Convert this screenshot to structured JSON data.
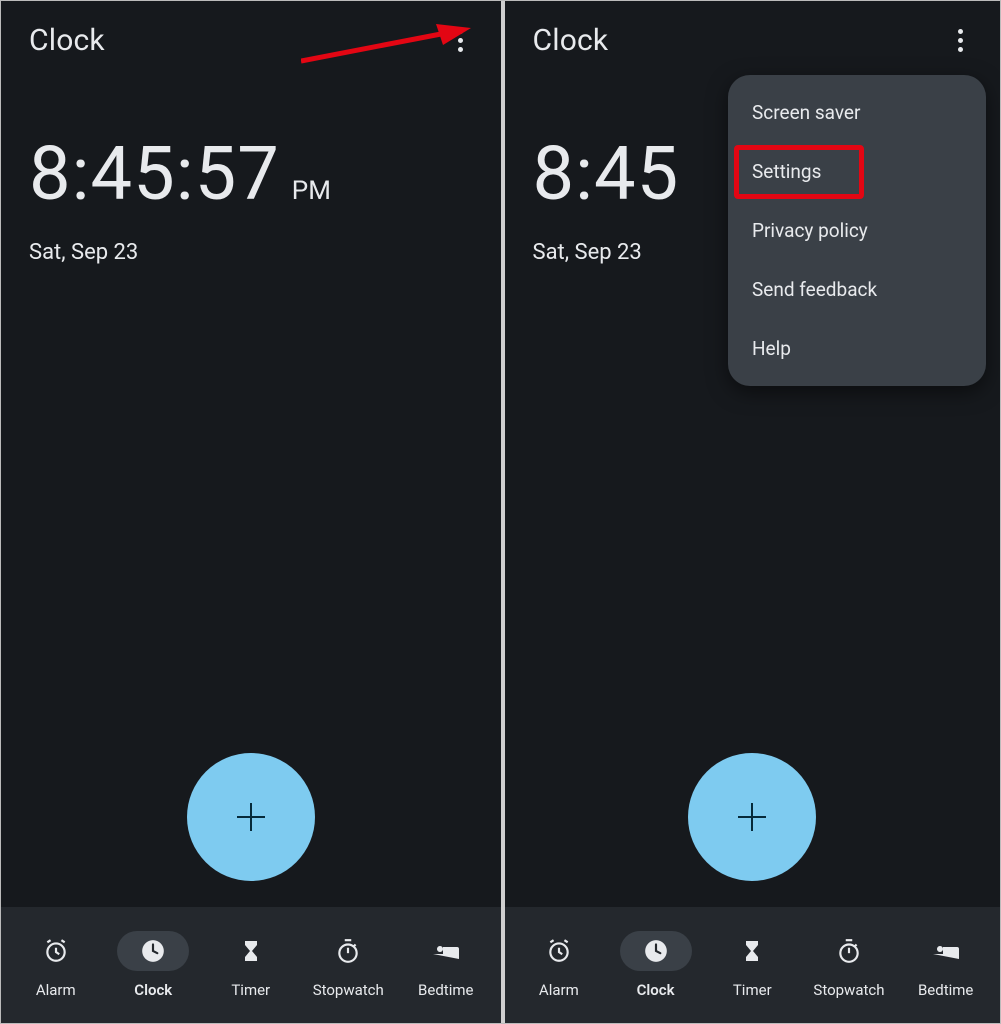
{
  "left": {
    "title": "Clock",
    "time": "8:45:57",
    "ampm": "PM",
    "date": "Sat, Sep 23"
  },
  "right": {
    "title": "Clock",
    "time": "8:45",
    "ampm": "",
    "date": "Sat, Sep 23",
    "menu": {
      "items": [
        {
          "label": "Screen saver"
        },
        {
          "label": "Settings"
        },
        {
          "label": "Privacy policy"
        },
        {
          "label": "Send feedback"
        },
        {
          "label": "Help"
        }
      ],
      "highlight_index": 1
    }
  },
  "nav": {
    "items": [
      {
        "label": "Alarm",
        "icon": "alarm-icon"
      },
      {
        "label": "Clock",
        "icon": "clock-icon"
      },
      {
        "label": "Timer",
        "icon": "hourglass-icon"
      },
      {
        "label": "Stopwatch",
        "icon": "stopwatch-icon"
      },
      {
        "label": "Bedtime",
        "icon": "bed-icon"
      }
    ],
    "active_index": 1
  },
  "colors": {
    "bg": "#16191d",
    "navbar": "#24282d",
    "menu": "#3a4047",
    "fab": "#7ecbf0",
    "highlight": "#e30613"
  }
}
